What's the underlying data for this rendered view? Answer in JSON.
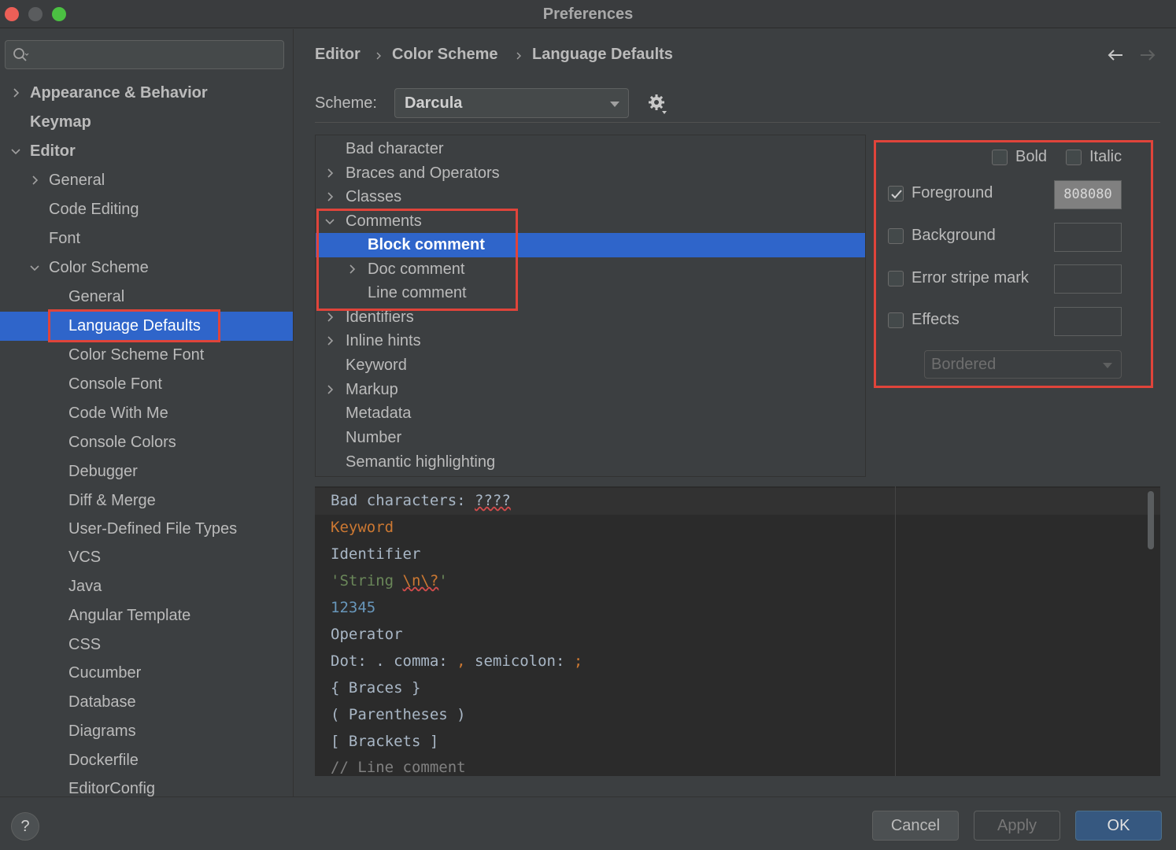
{
  "window": {
    "title": "Preferences"
  },
  "search": {
    "placeholder": ""
  },
  "sidebar": {
    "items": [
      {
        "label": "Appearance & Behavior",
        "expanded": false
      },
      {
        "label": "Keymap"
      },
      {
        "label": "Editor",
        "expanded": true
      },
      {
        "label": "General",
        "expanded": false
      },
      {
        "label": "Code Editing"
      },
      {
        "label": "Font"
      },
      {
        "label": "Color Scheme",
        "expanded": true
      },
      {
        "label": "General"
      },
      {
        "label": "Language Defaults",
        "selected": true
      },
      {
        "label": "Color Scheme Font"
      },
      {
        "label": "Console Font"
      },
      {
        "label": "Code With Me"
      },
      {
        "label": "Console Colors"
      },
      {
        "label": "Debugger"
      },
      {
        "label": "Diff & Merge"
      },
      {
        "label": "User-Defined File Types"
      },
      {
        "label": "VCS"
      },
      {
        "label": "Java"
      },
      {
        "label": "Angular Template"
      },
      {
        "label": "CSS"
      },
      {
        "label": "Cucumber"
      },
      {
        "label": "Database"
      },
      {
        "label": "Diagrams"
      },
      {
        "label": "Dockerfile"
      },
      {
        "label": "EditorConfig"
      }
    ]
  },
  "breadcrumb": [
    "Editor",
    "Color Scheme",
    "Language Defaults"
  ],
  "scheme": {
    "label": "Scheme:",
    "value": "Darcula"
  },
  "attributes": {
    "items": [
      {
        "label": "Bad character"
      },
      {
        "label": "Braces and Operators",
        "expandable": true
      },
      {
        "label": "Classes",
        "expandable": true
      },
      {
        "label": "Comments",
        "expanded": true
      },
      {
        "label": "Block comment",
        "selected": true
      },
      {
        "label": "Doc comment",
        "expandable": true
      },
      {
        "label": "Line comment"
      },
      {
        "label": "Identifiers",
        "expandable": true
      },
      {
        "label": "Inline hints",
        "expandable": true
      },
      {
        "label": "Keyword"
      },
      {
        "label": "Markup",
        "expandable": true
      },
      {
        "label": "Metadata"
      },
      {
        "label": "Number"
      },
      {
        "label": "Semantic highlighting"
      }
    ]
  },
  "options": {
    "bold": {
      "label": "Bold",
      "checked": false
    },
    "italic": {
      "label": "Italic",
      "checked": false
    },
    "foreground": {
      "label": "Foreground",
      "checked": true,
      "value": "808080",
      "color": "#808080"
    },
    "background": {
      "label": "Background",
      "checked": false,
      "value": ""
    },
    "error_stripe": {
      "label": "Error stripe mark",
      "checked": false,
      "value": ""
    },
    "effects": {
      "label": "Effects",
      "checked": false,
      "value": ""
    },
    "effect_type": "Bordered"
  },
  "preview": {
    "bad_chars_label": "Bad characters: ",
    "bad_chars_value": "????",
    "keyword": "Keyword",
    "identifier": "Identifier",
    "string_start": "'String ",
    "string_escape": "\\n\\?",
    "string_end": "'",
    "number": "12345",
    "operator": "Operator",
    "dot_label": "Dot: . comma: ",
    "comma": ",",
    "semicolon_label": " semicolon: ",
    "semicolon": ";",
    "braces": "{ Braces }",
    "parens": "( Parentheses )",
    "brackets": "[ Brackets ]",
    "line_comment": "// Line comment"
  },
  "buttons": {
    "cancel": "Cancel",
    "apply": "Apply",
    "ok": "OK",
    "help": "?"
  },
  "colors": {
    "accent": "#2f65ca",
    "highlight_box": "#e0443a",
    "keyword": "#cc7832",
    "string": "#6a8759",
    "number": "#6897bb",
    "comment": "#808080"
  }
}
